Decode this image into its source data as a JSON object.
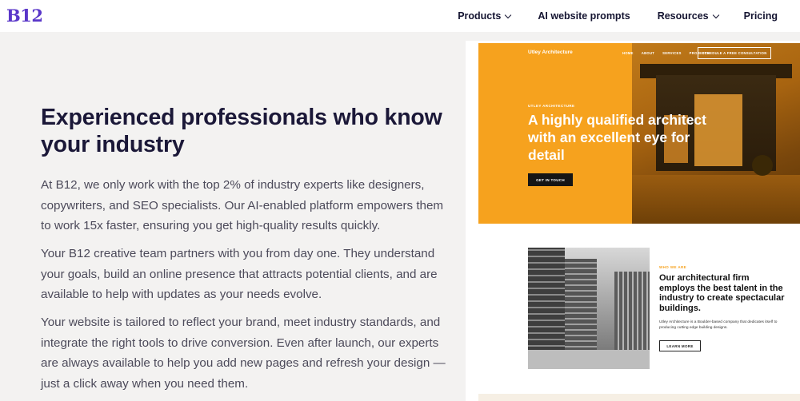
{
  "nav": {
    "logo": "B12",
    "items": [
      {
        "label": "Products",
        "has_dropdown": true
      },
      {
        "label": "AI website prompts",
        "has_dropdown": false
      },
      {
        "label": "Resources",
        "has_dropdown": true
      },
      {
        "label": "Pricing",
        "has_dropdown": false
      }
    ]
  },
  "main": {
    "headline": "Experienced professionals who know your industry",
    "paragraphs": [
      "At B12, we only work with the top 2% of industry experts like designers, copywriters, and SEO specialists. Our AI-enabled platform empowers them to work 15x faster, ensuring you get high-quality results quickly.",
      "Your B12 creative team partners with you from day one. They understand your goals, build an online presence that attracts potential clients, and are available to help with updates as your needs evolve.",
      "Your website is tailored to reflect your brand, meet industry standards, and integrate the right tools to drive conversion. Even after launch, our experts are always available to help you add new pages and refresh your design — just a click away when you need them."
    ]
  },
  "preview": {
    "brand": "Utley Architecture",
    "menu": [
      "HOME",
      "ABOUT",
      "SERVICES",
      "PROJECTS"
    ],
    "cta_top": "SCHEDULE A FREE CONSULTATION",
    "kicker": "UTLEY ARCHITECTURE",
    "hero_title": "A highly qualified architect with an excellent eye for detail",
    "hero_button": "GET IN TOUCH",
    "about_kicker": "WHO WE ARE",
    "about_title": "Our architectural firm employs the best talent in the industry to create spectacular buildings.",
    "about_body": "Utley Architecture is a Boulder-based company that dedicates itself to producing cutting edge building designs.",
    "about_button": "LEARN MORE"
  },
  "colors": {
    "brand": "#5a37c9",
    "hero_orange": "#f6a21e",
    "background": "#f3f2f1"
  }
}
